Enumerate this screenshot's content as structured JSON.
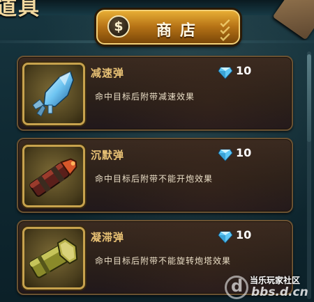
{
  "header": {
    "title_partial": "道具",
    "shop_label": "商店",
    "shop_icon": "$"
  },
  "items": [
    {
      "name": "减速弹",
      "description": "命中目标后附带减速效果",
      "price": "10",
      "currency_icon": "diamond-icon",
      "art": "ice-crystal-missile"
    },
    {
      "name": "沉默弹",
      "description": "命中目标后附带不能开炮效果",
      "price": "10",
      "currency_icon": "diamond-icon",
      "art": "red-tip-shell"
    },
    {
      "name": "凝滞弹",
      "description": "命中目标后附带不能旋转炮塔效果",
      "price": "10",
      "currency_icon": "diamond-icon",
      "art": "hexagon-bolt-shell"
    }
  ],
  "watermark": {
    "text": "当乐玩家社区",
    "url": "bbs.d.cn",
    "logo_letter": "d"
  },
  "colors": {
    "accent_gold": "#e7ad35",
    "item_name": "#e9c275",
    "gem_blue": "#6fd3ff",
    "background": "#0f2730"
  }
}
